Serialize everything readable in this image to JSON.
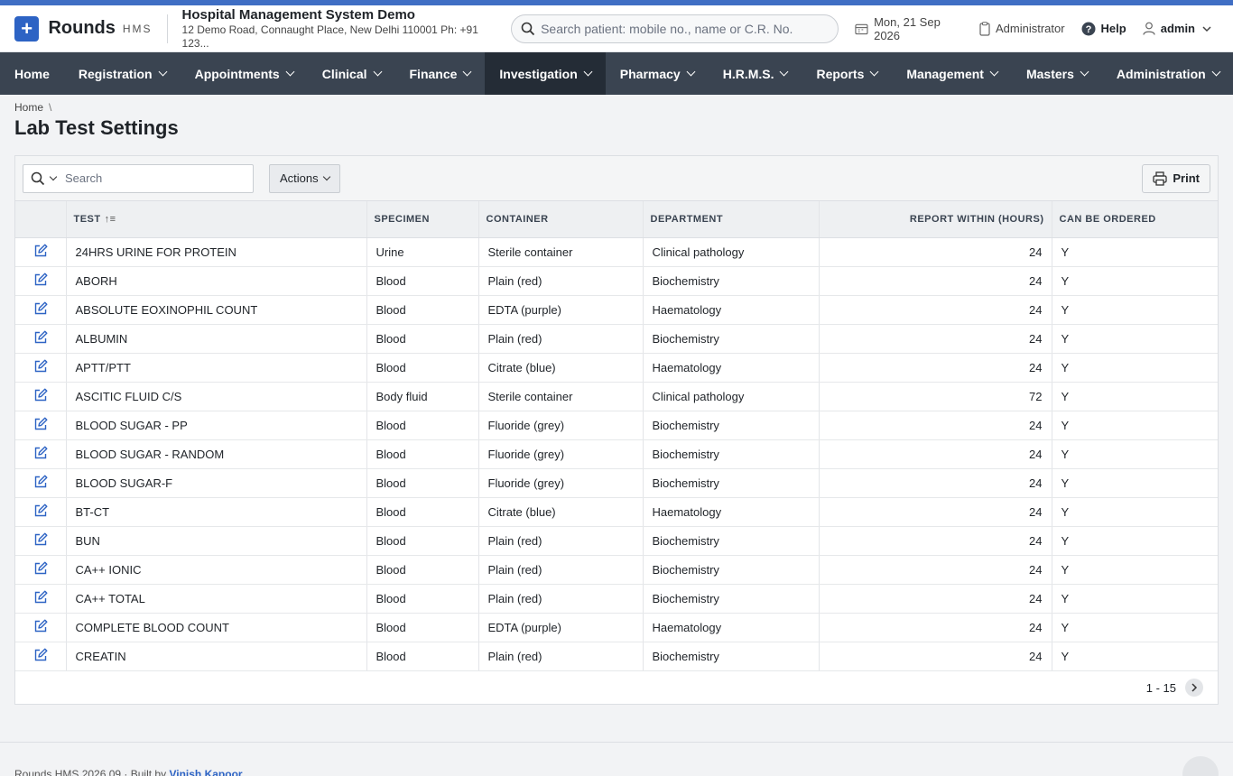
{
  "header": {
    "brand": "Rounds",
    "brand_sub": "HMS",
    "hospital_name": "Hospital Management System Demo",
    "hospital_address": "12 Demo Road, Connaught Place, New Delhi 110001 Ph: +91 123...",
    "search_placeholder": "Search patient: mobile no., name or C.R. No.",
    "date": "Mon, 21 Sep 2026",
    "role": "Administrator",
    "help": "Help",
    "user": "admin"
  },
  "nav": [
    "Home",
    "Registration",
    "Appointments",
    "Clinical",
    "Finance",
    "Investigation",
    "Pharmacy",
    "H.R.M.S.",
    "Reports",
    "Management",
    "Masters",
    "Administration"
  ],
  "breadcrumb": {
    "home": "Home",
    "sep": "\\"
  },
  "page_title": "Lab Test Settings",
  "toolbar": {
    "search_placeholder": "Search",
    "actions": "Actions",
    "print": "Print"
  },
  "columns": [
    "TEST",
    "SPECIMEN",
    "CONTAINER",
    "DEPARTMENT",
    "REPORT WITHIN (HOURS)",
    "CAN BE ORDERED"
  ],
  "rows": [
    [
      "24HRS URINE FOR PROTEIN",
      "Urine",
      "Sterile container",
      "Clinical pathology",
      "24",
      "Y"
    ],
    [
      "ABORH",
      "Blood",
      "Plain (red)",
      "Biochemistry",
      "24",
      "Y"
    ],
    [
      "ABSOLUTE EOXINOPHIL COUNT",
      "Blood",
      "EDTA (purple)",
      "Haematology",
      "24",
      "Y"
    ],
    [
      "ALBUMIN",
      "Blood",
      "Plain (red)",
      "Biochemistry",
      "24",
      "Y"
    ],
    [
      "APTT/PTT",
      "Blood",
      "Citrate (blue)",
      "Haematology",
      "24",
      "Y"
    ],
    [
      "ASCITIC FLUID C/S",
      "Body fluid",
      "Sterile container",
      "Clinical pathology",
      "72",
      "Y"
    ],
    [
      "BLOOD SUGAR - PP",
      "Blood",
      "Fluoride (grey)",
      "Biochemistry",
      "24",
      "Y"
    ],
    [
      "BLOOD SUGAR - RANDOM",
      "Blood",
      "Fluoride (grey)",
      "Biochemistry",
      "24",
      "Y"
    ],
    [
      "BLOOD SUGAR-F",
      "Blood",
      "Fluoride (grey)",
      "Biochemistry",
      "24",
      "Y"
    ],
    [
      "BT-CT",
      "Blood",
      "Citrate (blue)",
      "Haematology",
      "24",
      "Y"
    ],
    [
      "BUN",
      "Blood",
      "Plain (red)",
      "Biochemistry",
      "24",
      "Y"
    ],
    [
      "CA++ IONIC",
      "Blood",
      "Plain (red)",
      "Biochemistry",
      "24",
      "Y"
    ],
    [
      "CA++ TOTAL",
      "Blood",
      "Plain (red)",
      "Biochemistry",
      "24",
      "Y"
    ],
    [
      "COMPLETE BLOOD COUNT",
      "Blood",
      "EDTA (purple)",
      "Haematology",
      "24",
      "Y"
    ],
    [
      "CREATIN",
      "Blood",
      "Plain (red)",
      "Biochemistry",
      "24",
      "Y"
    ]
  ],
  "pagination": "1 - 15",
  "footer": {
    "version": "Rounds HMS 2026.09",
    "built_by": "· Built by",
    "author": "Vinish Kapoor"
  },
  "colors": {
    "accent": "#2d63c4",
    "nav_bg": "#3a4451",
    "nav_active": "#242c36"
  }
}
